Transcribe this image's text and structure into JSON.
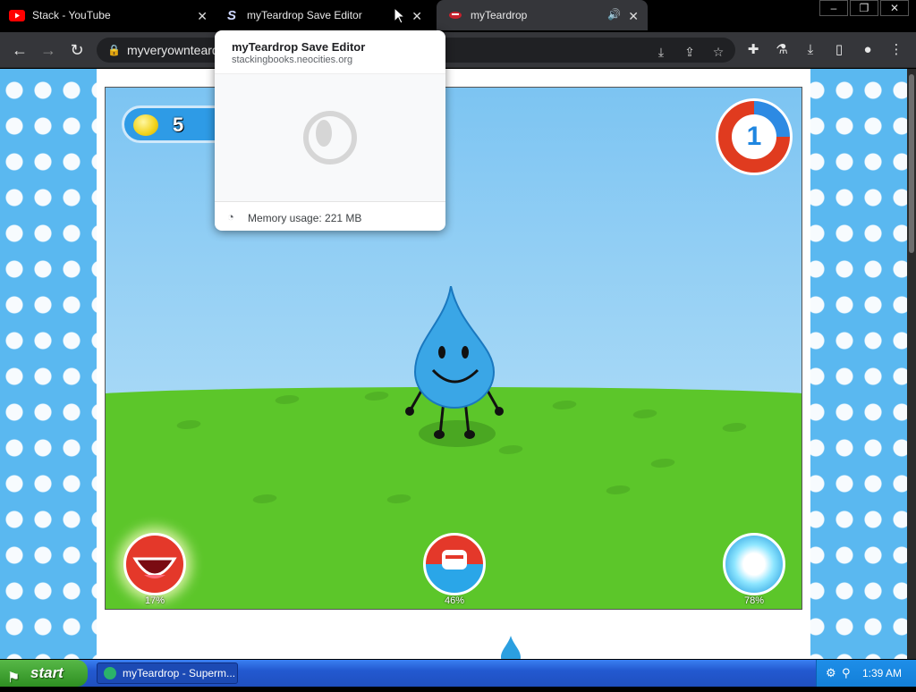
{
  "browser": {
    "tabs": [
      {
        "title": "Stack - YouTube",
        "icon": "youtube-icon"
      },
      {
        "title": "myTeardrop Save Editor",
        "icon": "site-icon"
      },
      {
        "title": "myTeardrop",
        "icon": "audio-icon"
      }
    ],
    "address": "myveryownteard",
    "window_controls": [
      "–",
      "❐",
      "✕"
    ]
  },
  "hovercard": {
    "title": "myTeardrop Save Editor",
    "url": "stackingbooks.neocities.org",
    "memory": "Memory usage: 221 MB"
  },
  "game": {
    "coins": "5",
    "level": "1",
    "stats": [
      {
        "label": "17%",
        "icon": "mouth-icon"
      },
      {
        "label": "46%",
        "icon": "food-icon"
      },
      {
        "label": "78%",
        "icon": "bubble-icon"
      }
    ]
  },
  "taskbar": {
    "start_label": "start",
    "task": "myTeardrop - Superm...",
    "clock": "1:39 AM"
  },
  "colors": {
    "sky": "#7cc4f2",
    "ground": "#5cc62a",
    "accent_blue": "#2e9be6",
    "level_red": "#e03b1f"
  }
}
